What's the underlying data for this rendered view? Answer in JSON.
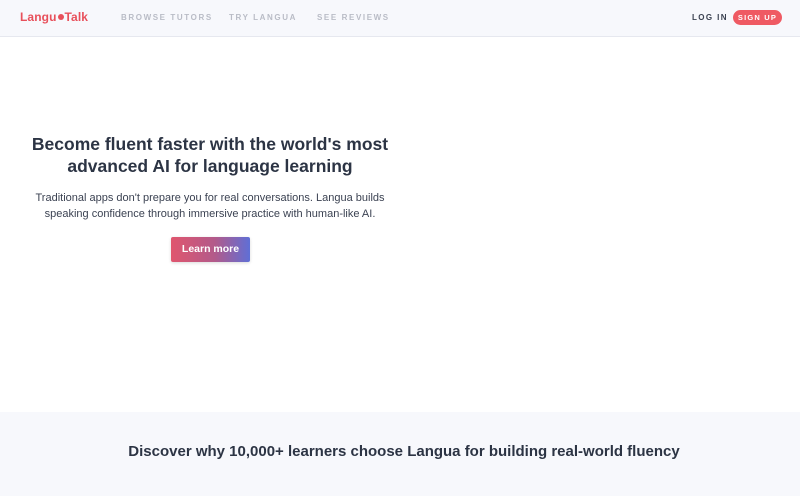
{
  "nav": {
    "logo_left": "Langu",
    "logo_right": "Talk",
    "links": [
      "BROWSE TUTORS",
      "TRY LANGUA",
      "SEE REVIEWS"
    ],
    "login": "LOG IN",
    "signup": "SIGN UP"
  },
  "hero": {
    "title": "Become fluent faster with the world's most advanced AI for language learning",
    "subtitle": "Traditional apps don't prepare you for real conversations. Langua builds speaking confidence through immersive practice with human-like AI.",
    "cta": "Learn more"
  },
  "discover": {
    "title": "Discover why 10,000+ learners choose Langua for building real-world fluency"
  },
  "colors": {
    "brand": "#e8505b",
    "signup_bg": "#ef5a63",
    "cta_gradient": [
      "#e0566e",
      "#5f6fd6"
    ]
  }
}
